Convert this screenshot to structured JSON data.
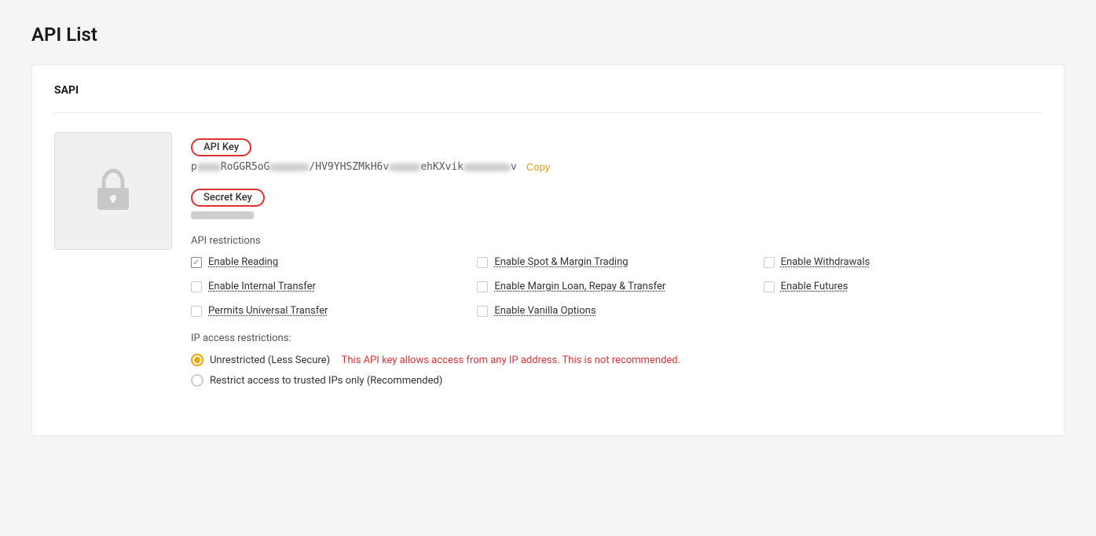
{
  "page": {
    "title": "API List"
  },
  "section": {
    "label": "SAPI"
  },
  "api_key": {
    "label": "API Key",
    "value_prefix": "p••••Yt•RoGGR5oG",
    "value_middle": "•••/HV9YHSZMkH6v••",
    "value_end": "•ehKXvik•••••••••v",
    "copy_label": "Copy"
  },
  "secret_key": {
    "label": "Secret Key"
  },
  "restrictions": {
    "section_label": "API restrictions",
    "items": [
      {
        "id": "enable-reading",
        "label": "Enable Reading",
        "checked": true,
        "col": 0
      },
      {
        "id": "enable-spot",
        "label": "Enable Spot & Margin Trading",
        "checked": false,
        "col": 1
      },
      {
        "id": "enable-withdrawals",
        "label": "Enable Withdrawals",
        "checked": false,
        "col": 2
      },
      {
        "id": "enable-internal-transfer",
        "label": "Enable Internal Transfer",
        "checked": false,
        "col": 0
      },
      {
        "id": "enable-margin-loan",
        "label": "Enable Margin Loan, Repay & Transfer",
        "checked": false,
        "col": 1
      },
      {
        "id": "enable-futures",
        "label": "Enable Futures",
        "checked": false,
        "col": 2
      },
      {
        "id": "permits-universal-transfer",
        "label": "Permits Universal Transfer",
        "checked": false,
        "col": 0
      },
      {
        "id": "enable-vanilla-options",
        "label": "Enable Vanilla Options",
        "checked": false,
        "col": 1
      }
    ]
  },
  "ip_restrictions": {
    "label": "IP access restrictions:",
    "options": [
      {
        "id": "unrestricted",
        "label": "Unrestricted (Less Secure)",
        "warning": "This API key allows access from any IP address. This is not recommended.",
        "selected": true
      },
      {
        "id": "restricted",
        "label": "Restrict access to trusted IPs only (Recommended)",
        "warning": "",
        "selected": false
      }
    ]
  }
}
